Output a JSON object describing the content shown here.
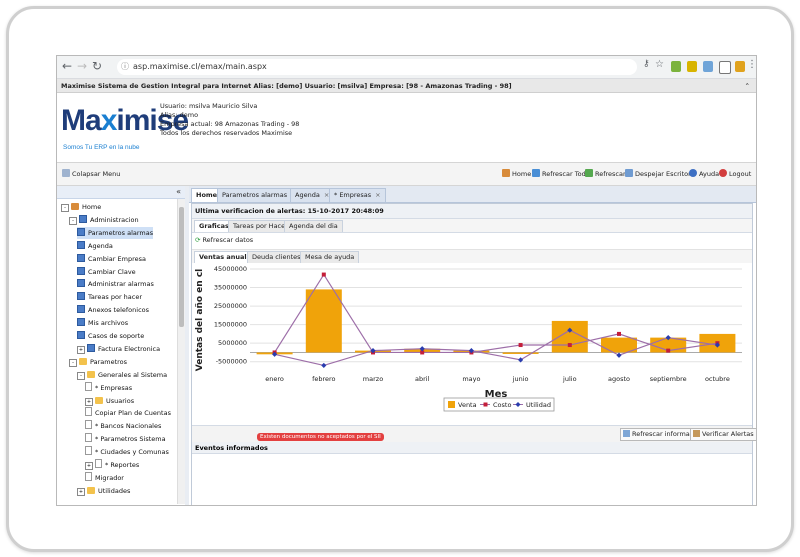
{
  "browser": {
    "url": "asp.maximise.cl/emax/main.aspx",
    "back": "←",
    "forward": "→",
    "reload": "↻"
  },
  "window_title": "Maximise Sistema de Gestion Integral para Internet Alias: [demo] Usuario: [msilva] Empresa: [98 - Amazonas Trading - 98]",
  "header": {
    "logo_text_a": "Ma",
    "logo_text_x": "x",
    "logo_text_b": "imise",
    "tagline": "Somos Tu ERP en la nube",
    "user_lines": [
      "Usuario: msilva Mauricio Silva",
      "Alias: demo",
      "Empresa actual: 98 Amazonas Trading - 98",
      "Todos los derechos reservados Maximise"
    ]
  },
  "toolbar": {
    "collapse": "Colapsar Menu",
    "home": "Home",
    "refresh_all": "Refrescar Todo",
    "refresh": "Refrescar",
    "clear_desktop": "Despejar Escritorio",
    "help": "Ayuda",
    "logout": "Logout"
  },
  "sidebar": {
    "collapse_glyph": "«",
    "tree": [
      {
        "label": "Home",
        "level": 0,
        "type": "home",
        "toggle": "-"
      },
      {
        "label": "Administracion",
        "level": 1,
        "type": "form",
        "toggle": "-"
      },
      {
        "label": "Parametros alarmas",
        "level": 2,
        "type": "form",
        "selected": true
      },
      {
        "label": "Agenda",
        "level": 2,
        "type": "form"
      },
      {
        "label": "Cambiar Empresa",
        "level": 2,
        "type": "form"
      },
      {
        "label": "Cambiar Clave",
        "level": 2,
        "type": "form"
      },
      {
        "label": "Administrar alarmas",
        "level": 2,
        "type": "form"
      },
      {
        "label": "Tareas por hacer",
        "level": 2,
        "type": "form"
      },
      {
        "label": "Anexos telefonicos",
        "level": 2,
        "type": "form"
      },
      {
        "label": "Mis archivos",
        "level": 2,
        "type": "form"
      },
      {
        "label": "Casos de soporte",
        "level": 2,
        "type": "form"
      },
      {
        "label": "Factura Electronica",
        "level": 2,
        "type": "form",
        "toggle": "+"
      },
      {
        "label": "Parametros",
        "level": 1,
        "type": "folder",
        "toggle": "-"
      },
      {
        "label": "Generales al Sistema",
        "level": 2,
        "type": "folder",
        "toggle": "-"
      },
      {
        "label": "* Empresas",
        "level": 3,
        "type": "doc"
      },
      {
        "label": "Usuarios",
        "level": 3,
        "type": "folder",
        "toggle": "+"
      },
      {
        "label": "Copiar Plan de Cuentas",
        "level": 3,
        "type": "doc"
      },
      {
        "label": "* Bancos Nacionales",
        "level": 3,
        "type": "doc"
      },
      {
        "label": "* Parametros Sistema",
        "level": 3,
        "type": "doc"
      },
      {
        "label": "* Ciudades y Comunas",
        "level": 3,
        "type": "doc"
      },
      {
        "label": "* Reportes",
        "level": 3,
        "type": "doc",
        "toggle": "+"
      },
      {
        "label": "Migrador",
        "level": 3,
        "type": "doc"
      },
      {
        "label": "Utilidades",
        "level": 2,
        "type": "folder",
        "toggle": "+"
      }
    ]
  },
  "tabs": [
    {
      "label": "Home",
      "active": true,
      "closable": false
    },
    {
      "label": "Parametros alarmas",
      "active": false,
      "closable": true
    },
    {
      "label": "Agenda",
      "active": false,
      "closable": true
    },
    {
      "label": "* Empresas",
      "active": false,
      "closable": true
    }
  ],
  "alerts_header": "Ultima verificacion de alertas: 15-10-2017 20:48:09",
  "subtabs": [
    "Graficas",
    "Tareas por Hacer",
    "Agenda del dia"
  ],
  "refresh_data": "Refrescar datos",
  "chart_tabs": [
    "Ventas anuales",
    "Deuda clientes",
    "Mesa de ayuda"
  ],
  "bottom_buttons": {
    "refresh_info": "Refrescar informacion",
    "verify_alerts": "Verificar Alertas"
  },
  "events_header": "Eventos informados",
  "events_badge": "Existen documentos no aceptados por el SII",
  "colors": {
    "venta": "#f0a30a",
    "costo": "#c41e3a",
    "utilidad": "#2a3cae",
    "line": "#9d6ea8"
  },
  "chart_data": {
    "type": "bar",
    "categories": [
      "enero",
      "febrero",
      "marzo",
      "abril",
      "mayo",
      "junio",
      "julio",
      "agosto",
      "septiembre",
      "octubre"
    ],
    "xlabel": "Mes",
    "ylabel": "Ventas del año en cl",
    "yticks": [
      "45000000",
      "35000000",
      "25000000",
      "15000000",
      "5000000",
      "-5000000"
    ],
    "ylim": [
      -10000000,
      45000000
    ],
    "series": [
      {
        "name": "Venta",
        "kind": "bar",
        "values": [
          -1000000,
          34000000,
          1000000,
          2000000,
          1000000,
          0,
          17000000,
          8000000,
          8000000,
          10000000
        ]
      },
      {
        "name": "Costo",
        "kind": "line",
        "values": [
          0,
          42000000,
          0,
          0,
          0,
          4000000,
          4000000,
          10000000,
          1000000,
          5000000
        ]
      },
      {
        "name": "Utilidad",
        "kind": "line",
        "values": [
          -1000000,
          -7000000,
          1000000,
          2000000,
          1000000,
          -4000000,
          12000000,
          -1500000,
          8000000,
          4000000
        ]
      }
    ],
    "legend_position": "bottom"
  }
}
